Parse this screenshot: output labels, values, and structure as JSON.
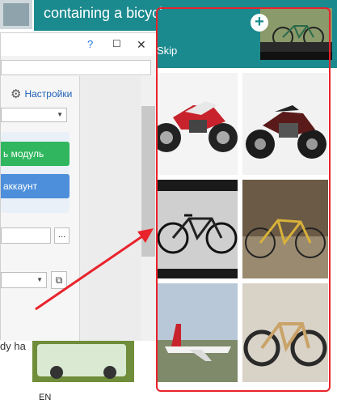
{
  "background": {
    "bottom_left_text": "dy ha",
    "lang_indicator": "EN"
  },
  "dialog": {
    "title_buttons": {
      "help": "?",
      "maximize": "☐",
      "close": "✕"
    },
    "settings_link": "Настройки",
    "settings_icon": "gear-icon",
    "add_module_label": "ь модуль",
    "account_label": "аккаунт",
    "browse_label": "...",
    "copy_icon": "copy-icon"
  },
  "captcha": {
    "title": "containing a bicycle",
    "skip_label": "Skip",
    "add_icon": "plus-icon",
    "tiles": [
      {
        "subject": "motorcycle-red"
      },
      {
        "subject": "motorcycle-dark"
      },
      {
        "subject": "bicycle-black"
      },
      {
        "subject": "bicycle-yellow"
      },
      {
        "subject": "airplane"
      },
      {
        "subject": "bicycle-tan"
      }
    ]
  },
  "annotation": {
    "highlight_color": "#e8232c",
    "arrow_color": "#e8232c"
  }
}
